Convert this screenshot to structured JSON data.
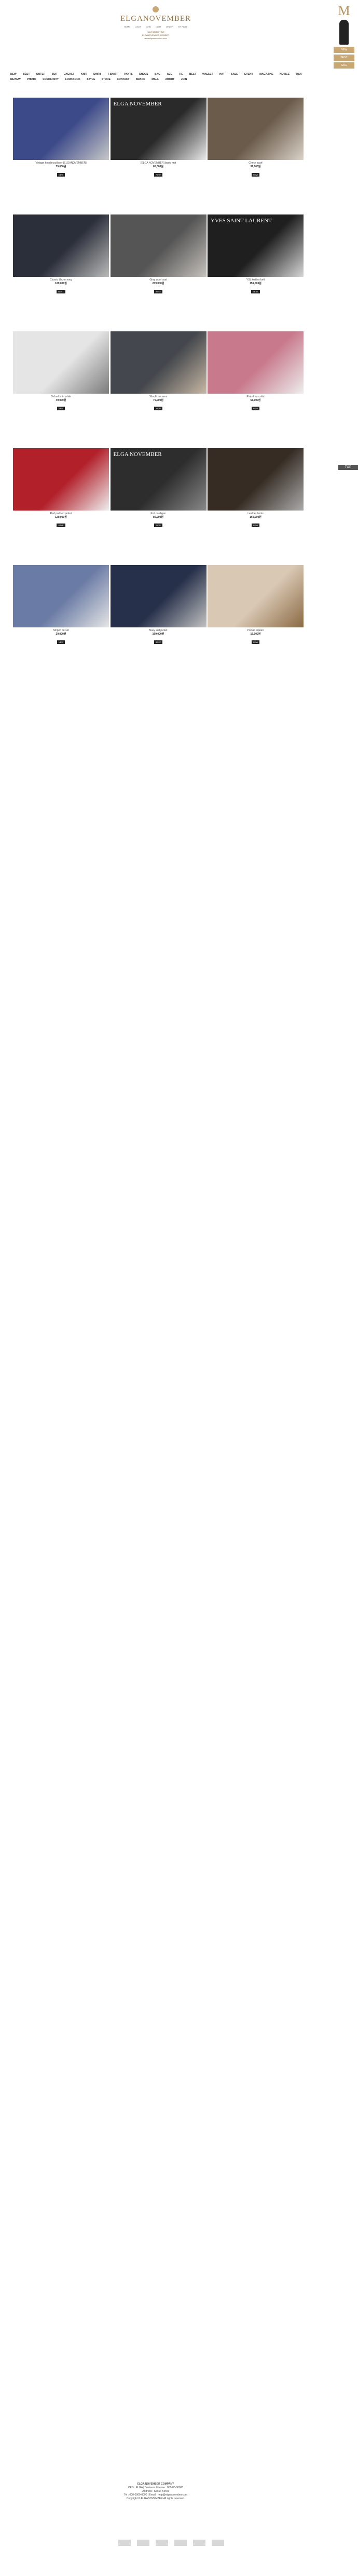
{
  "brand": "ELGANOVEMBER",
  "topnav": [
    "HOME",
    "LOGIN",
    "JOIN",
    "CART",
    "ORDER",
    "MY PAGE"
  ],
  "notice": [
    "NOVEMBER TIME",
    "ELGANOVEMBER MEMBER",
    "www.elganovember.com"
  ],
  "categories": [
    "NEW",
    "BEST",
    "OUTER",
    "SUIT",
    "JACKET",
    "KNIT",
    "SHIRT",
    "T-SHIRT",
    "PANTS",
    "SHOES",
    "BAG",
    "ACC",
    "TIE",
    "BELT",
    "WALLET",
    "HAT",
    "SALE",
    "EVENT",
    "MAGAZINE",
    "NOTICE",
    "Q&A",
    "REVIEW",
    "PHOTO",
    "COMMUNITY",
    "LOOKBOOK",
    "STYLE",
    "STORE",
    "CONTACT",
    "BRAND",
    "MALL",
    "ABOUT",
    "JOIN"
  ],
  "sidebar": {
    "mark": "M",
    "box1": "NEW",
    "box2": "BEST",
    "box3": "SALE",
    "tag": "TOP"
  },
  "products": [
    {
      "label": "",
      "name": "Vintage hoodie pullover [ELGANOVEMBER]",
      "price": "75,000원",
      "badge": "NEW",
      "c1": "#3c4a8a",
      "c2": "#c8c8c8",
      "light": false
    },
    {
      "label": "ELGA NOVEMBER",
      "name": "[ELGA NOVEMBER] basic knit",
      "price": "65,000원",
      "badge": "NEW",
      "c1": "#2a2a2a",
      "c2": "#e9e9e9",
      "light": false
    },
    {
      "label": "",
      "name": "Check scarf",
      "price": "39,000원",
      "badge": "NEW",
      "c1": "#6b5b4b",
      "c2": "#d9d2c7",
      "light": false
    },
    {
      "label": "",
      "name": "Classic blazer navy",
      "price": "189,000원",
      "badge": "BEST",
      "c1": "#2b2f3a",
      "c2": "#b9b9b9",
      "light": false
    },
    {
      "label": "",
      "name": "Gray wool coat",
      "price": "239,000원",
      "badge": "BEST",
      "c1": "#555555",
      "c2": "#c5c1bb",
      "light": false
    },
    {
      "label": "YVES SAINT LAURENT",
      "name": "YSL leather belt",
      "price": "159,000원",
      "badge": "BEST",
      "c1": "#1f1f1f",
      "c2": "#d6d6d6",
      "light": false
    },
    {
      "label": "",
      "name": "Oxford shirt white",
      "price": "49,000원",
      "badge": "NEW",
      "c1": "#e5e5e5",
      "c2": "#7c7c7c",
      "light": true
    },
    {
      "label": "",
      "name": "Slim fit trousers",
      "price": "79,000원",
      "badge": "NEW",
      "c1": "#44474d",
      "c2": "#c6b7a3",
      "light": false
    },
    {
      "label": "",
      "name": "Pink dress shirt",
      "price": "55,000원",
      "badge": "NEW",
      "c1": "#c87a8c",
      "c2": "#ededed",
      "light": false
    },
    {
      "label": "",
      "name": "Red padded jacket",
      "price": "129,000원",
      "badge": "SALE",
      "c1": "#b2202a",
      "c2": "#eee",
      "light": false
    },
    {
      "label": "ELGA NOVEMBER",
      "name": "Knit cardigan",
      "price": "89,000원",
      "badge": "NEW",
      "c1": "#2d2d2d",
      "c2": "#888",
      "light": false
    },
    {
      "label": "",
      "name": "Leather boots",
      "price": "169,000원",
      "badge": "NEW",
      "c1": "#362c24",
      "c2": "#aaa",
      "light": false
    },
    {
      "label": "",
      "name": "Striped tie set",
      "price": "29,000원",
      "badge": "NEW",
      "c1": "#6a7ba5",
      "c2": "#e5e5e5",
      "light": false
    },
    {
      "label": "",
      "name": "Navy suit jacket",
      "price": "199,000원",
      "badge": "BEST",
      "c1": "#26304a",
      "c2": "#c1c1c1",
      "light": false
    },
    {
      "label": "",
      "name": "Pocket square",
      "price": "19,000원",
      "badge": "NEW",
      "c1": "#d9c8b4",
      "c2": "#8b6a44",
      "light": true
    }
  ],
  "footer": {
    "company": "ELGA NOVEMBER COMPANY",
    "lines": [
      "CEO : ELGA  |  Business License : 000-00-00000",
      "Address : Seoul, Korea",
      "Tel : 000-0000-0000  |  Email : help@elganovember.com",
      "Copyright © ELGANOVEMBER All rights reserved."
    ]
  }
}
